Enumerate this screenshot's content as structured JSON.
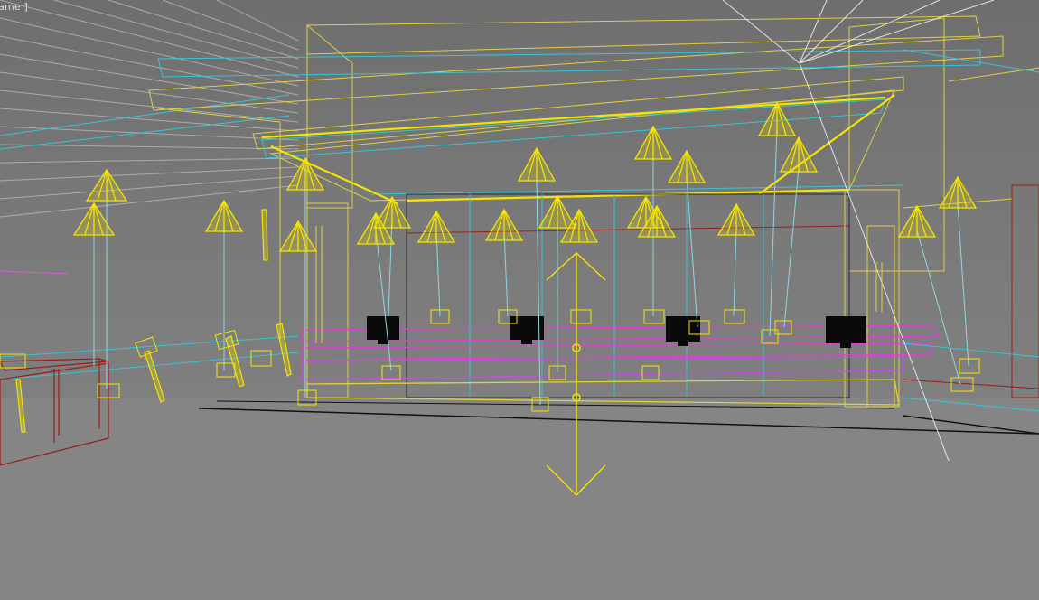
{
  "viewport": {
    "label": "ame ]"
  },
  "colors": {
    "background": "#7c7c7c",
    "light_gizmo": "#f5e400",
    "light_target": "#ffff66",
    "wire_cyan": "#35c6d6",
    "wire_yellow": "#e0d040",
    "wire_red": "#9a1d1d",
    "wire_magenta": "#e040d0",
    "wire_white": "#f0f0f0",
    "monitor": "#0a0a0a"
  },
  "objects": {
    "spotlights": 26,
    "monitors": 4
  }
}
